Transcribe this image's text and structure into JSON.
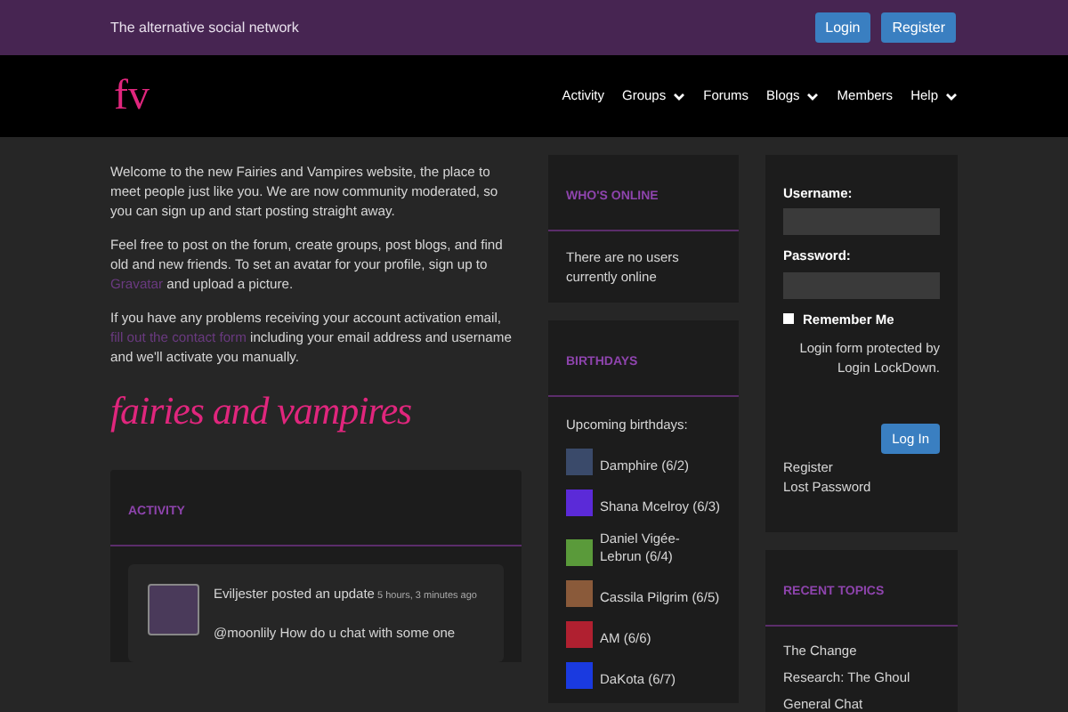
{
  "topbar": {
    "tagline": "The alternative social network",
    "buttons": [
      "Login",
      "Register"
    ]
  },
  "nav": {
    "logo": "fv",
    "items": [
      {
        "label": "Activity",
        "dropdown": false
      },
      {
        "label": "Groups",
        "dropdown": true
      },
      {
        "label": "Forums",
        "dropdown": false
      },
      {
        "label": "Blogs",
        "dropdown": true
      },
      {
        "label": "Members",
        "dropdown": false
      },
      {
        "label": "Help",
        "dropdown": true
      }
    ]
  },
  "intro": [
    {
      "before": "Welcome to the new Fairies and Vampires website, the place to meet people just like you. We are now community moderated, so you can sign up and start posting straight away."
    },
    {
      "before": "Feel free to post on the forum, create groups, post blogs, and find old and new friends. To set an avatar for your profile, sign up to ",
      "link": "Gravatar",
      "after": " and upload a picture."
    },
    {
      "before": "If you have any problems receiving your account activation email, ",
      "link": "fill out the contact form",
      "after": " including your email address and username and we'll activate you manually."
    }
  ],
  "banner": "fairies and vampires",
  "activity": {
    "title": "ACTIVITY",
    "items": [
      {
        "author": "Eviljester posted an update",
        "time": "5 hours, 3 minutes ago",
        "text": "@moonlily How do u chat with some one"
      }
    ]
  },
  "whos_online": {
    "title": "WHO'S ONLINE",
    "text": "There are no users currently online"
  },
  "birthdays": {
    "title": "BIRTHDAYS",
    "intro": "Upcoming birthdays:",
    "items": [
      {
        "name": "Damphire",
        "date": "(6/2)",
        "color": "#3a4a6a"
      },
      {
        "name": "Shana Mcelroy",
        "date": "(6/3)",
        "color": "#5b2ad8"
      },
      {
        "name": "Daniel Vigée-Lebrun",
        "date": "(6/4)",
        "color": "#5a9a3a"
      },
      {
        "name": "Cassila Pilgrim",
        "date": "(6/5)",
        "color": "#8a5a3a"
      },
      {
        "name": "AM",
        "date": "(6/6)",
        "color": "#b02030"
      },
      {
        "name": "DaKota",
        "date": "(6/7)",
        "color": "#1a3ae0"
      }
    ]
  },
  "login": {
    "username_label": "Username:",
    "password_label": "Password:",
    "remember": {
      "label": "Remember Me",
      "checked": false
    },
    "note": "Login form protected by Login LockDown.",
    "submit": "Log In",
    "links": [
      "Register",
      "Lost Password"
    ]
  },
  "recent_topics": {
    "title": "RECENT TOPICS",
    "items": [
      "The Change",
      "Research: The Ghoul",
      "General Chat"
    ]
  }
}
